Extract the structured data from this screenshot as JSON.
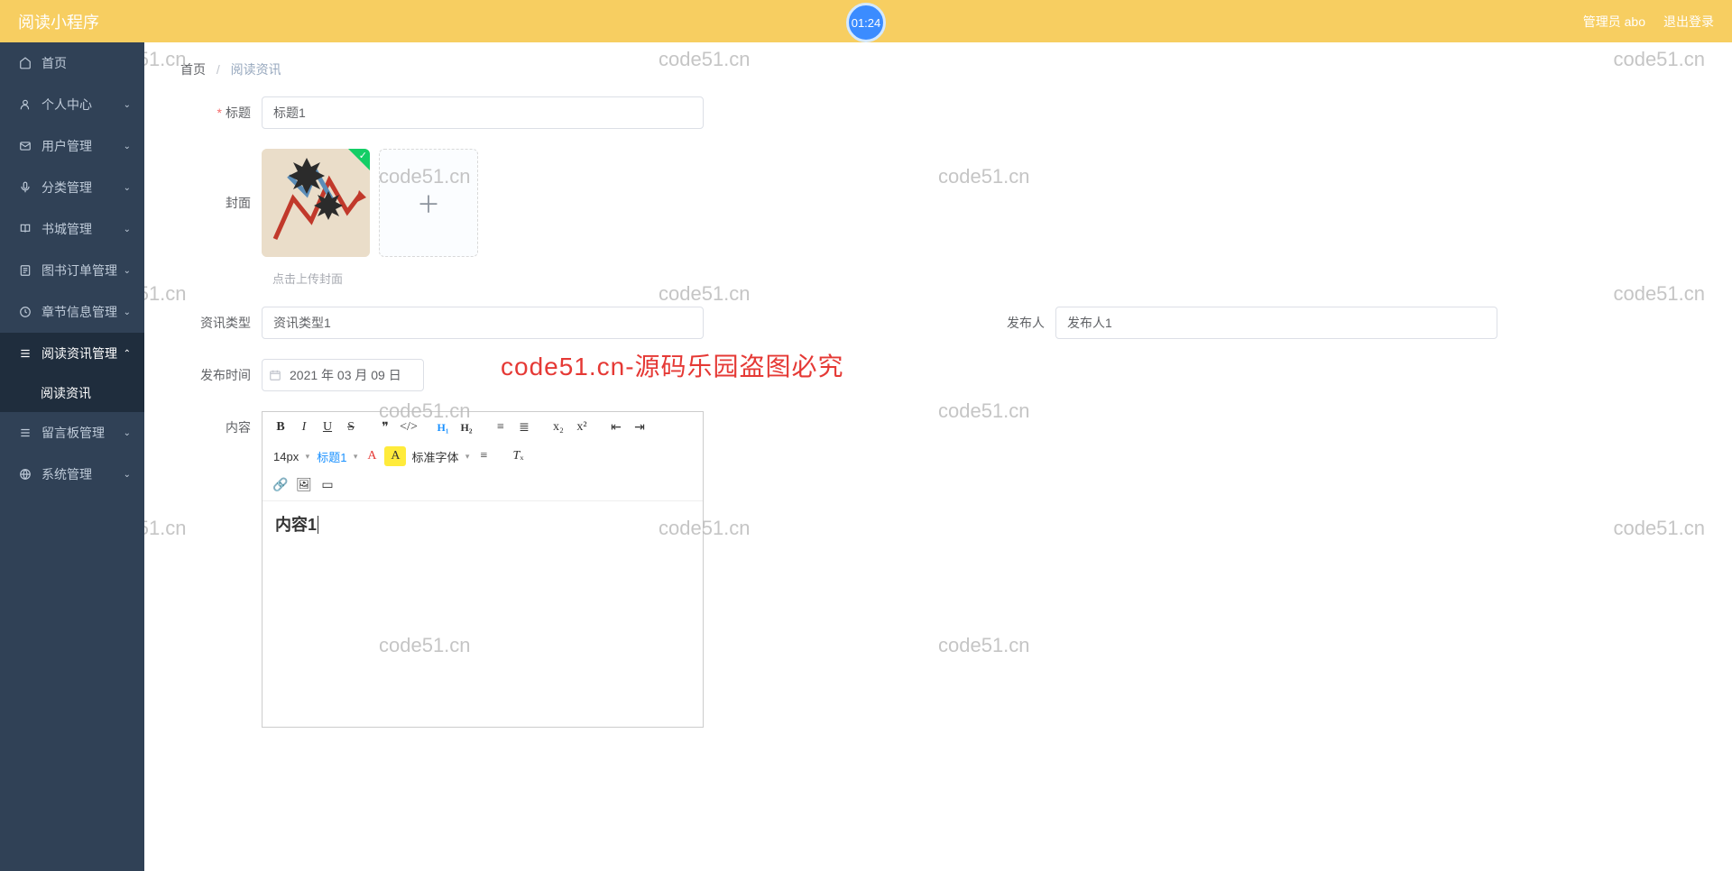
{
  "header": {
    "app_title": "阅读小程序",
    "timer": "01:24",
    "admin_label": "管理员 abo",
    "logout_label": "退出登录"
  },
  "sidebar": {
    "items": [
      {
        "icon": "home",
        "label": "首页",
        "expandable": false
      },
      {
        "icon": "user",
        "label": "个人中心",
        "expandable": true
      },
      {
        "icon": "mail",
        "label": "用户管理",
        "expandable": true
      },
      {
        "icon": "mic",
        "label": "分类管理",
        "expandable": true
      },
      {
        "icon": "book",
        "label": "书城管理",
        "expandable": true
      },
      {
        "icon": "order",
        "label": "图书订单管理",
        "expandable": true
      },
      {
        "icon": "clock",
        "label": "章节信息管理",
        "expandable": true
      },
      {
        "icon": "list",
        "label": "阅读资讯管理",
        "expandable": true,
        "expanded": true
      },
      {
        "icon": "list",
        "label": "留言板管理",
        "expandable": true
      },
      {
        "icon": "globe",
        "label": "系统管理",
        "expandable": true
      }
    ],
    "active_sub": "阅读资讯"
  },
  "breadcrumb": {
    "root": "首页",
    "current": "阅读资讯"
  },
  "form": {
    "title_label": "标题",
    "title_value": "标题1",
    "cover_label": "封面",
    "upload_hint": "点击上传封面",
    "info_type_label": "资讯类型",
    "info_type_value": "资讯类型1",
    "publisher_label": "发布人",
    "publisher_value": "发布人1",
    "publish_time_label": "发布时间",
    "publish_time_value": "2021 年 03 月 09 日",
    "content_label": "内容",
    "content_value": "内容1"
  },
  "editor": {
    "font_size": "14px",
    "heading": "标题1",
    "font_family": "标准字体"
  },
  "watermarks": {
    "text": "code51.cn",
    "red_text": "code51.cn-源码乐园盗图必究"
  }
}
